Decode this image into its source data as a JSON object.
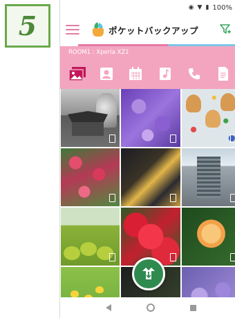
{
  "step": {
    "number": "5"
  },
  "statusbar": {
    "battery_text": "100%"
  },
  "appbar": {
    "title": "ポケットバックアップ"
  },
  "room": {
    "label": "ROOM1 : Xperia XZ1"
  },
  "categories": [
    {
      "name": "photos",
      "icon": "photo-icon"
    },
    {
      "name": "contacts",
      "icon": "contact-icon"
    },
    {
      "name": "calendar",
      "icon": "calendar-icon"
    },
    {
      "name": "music",
      "icon": "music-icon"
    },
    {
      "name": "call-log",
      "icon": "phone-icon"
    },
    {
      "name": "documents",
      "icon": "document-icon"
    }
  ],
  "colors": {
    "accent_pink": "#f3a5c0",
    "selected_category": "#c2185b",
    "fab_green": "#2f8a4f",
    "badge_green": "#6aa84a"
  }
}
